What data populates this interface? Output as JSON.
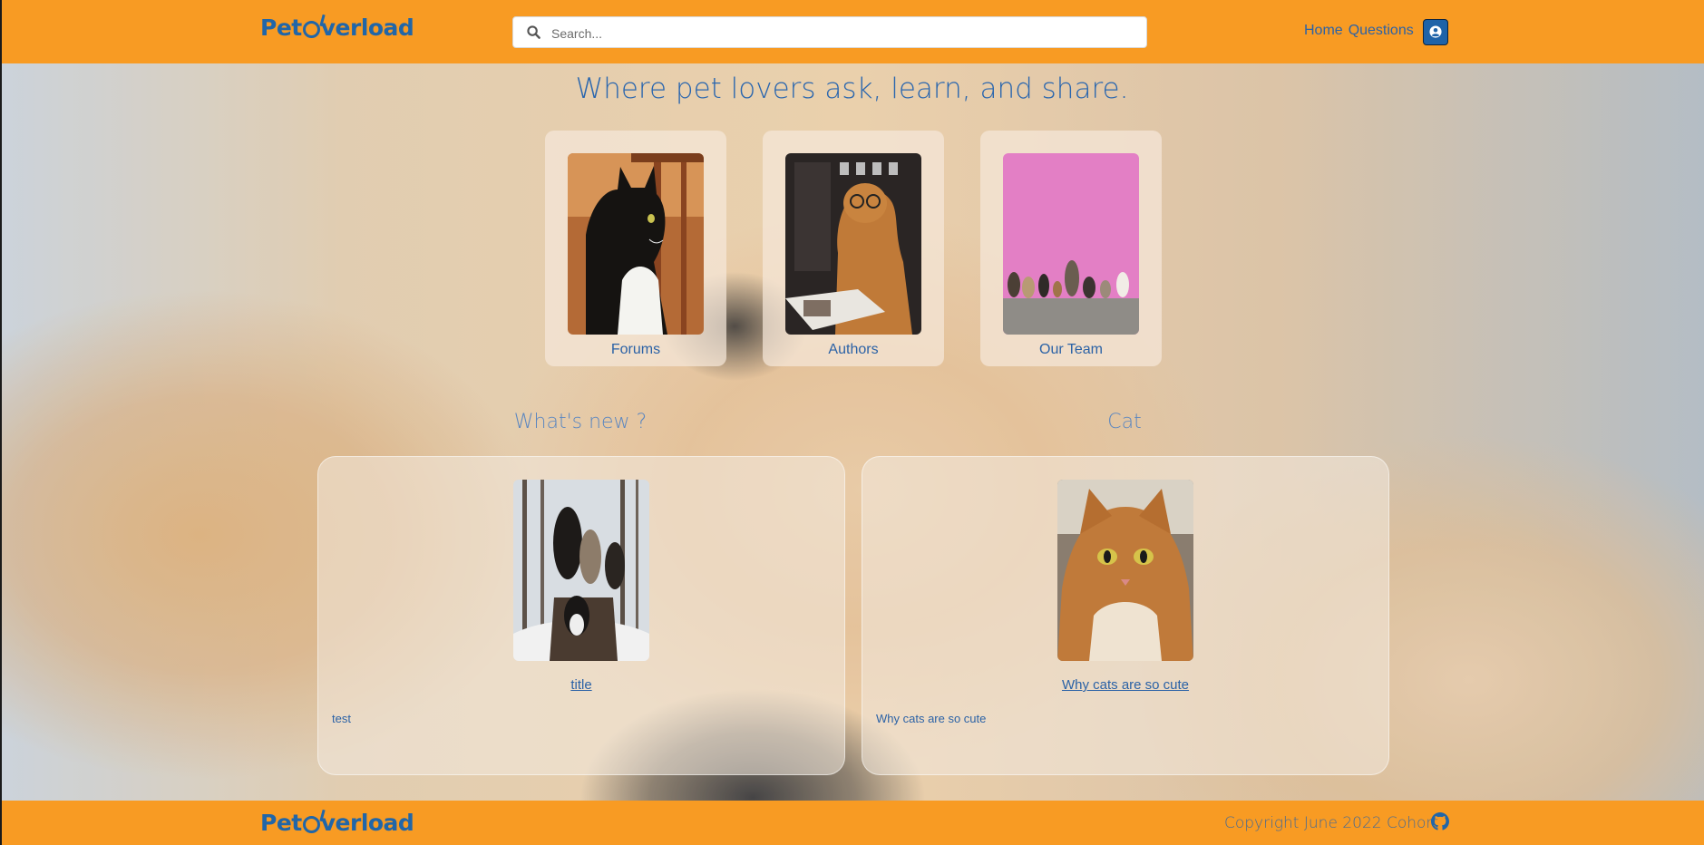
{
  "brand": {
    "name": "PetOverload",
    "name_prefix": "Pet",
    "name_suffix": "verload"
  },
  "header": {
    "search": {
      "placeholder": "Search..."
    },
    "nav": [
      {
        "label": "Home"
      },
      {
        "label": "Questions"
      }
    ],
    "user_icon": "user-circle-icon"
  },
  "hero": {
    "tagline": "Where pet lovers ask, learn, and share.",
    "cards": [
      {
        "label": "Forums",
        "image": "black-and-white cat looking sideways"
      },
      {
        "label": "Authors",
        "image": "dog with glasses reading a magazine"
      },
      {
        "label": "Our Team",
        "image": "row of dogs and cats against pink wall"
      }
    ]
  },
  "sections": [
    {
      "title": "What's new ?",
      "post": {
        "title": "title",
        "body": "test"
      }
    },
    {
      "title": "Cat",
      "post": {
        "title": "Why cats are so cute",
        "body": "Why cats are so cute"
      }
    }
  ],
  "footer": {
    "copyright": "Copyright June 2022 Cohort",
    "icon": "github-icon"
  },
  "colors": {
    "nav_bg": "#f89b23",
    "brand_blue": "#2166a8",
    "link": "#2b62a6"
  }
}
